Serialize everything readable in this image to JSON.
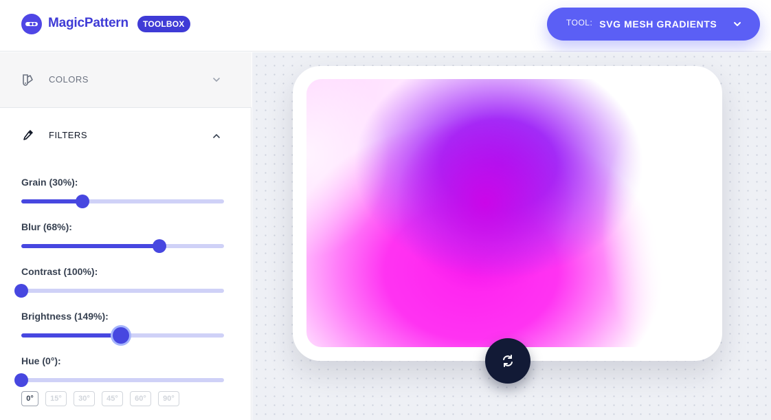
{
  "header": {
    "brand": "MagicPattern",
    "badge": "TOOLBOX",
    "tool_prefix": "TOOL:",
    "tool_name": "SVG MESH GRADIENTS"
  },
  "sidebar": {
    "colors_label": "COLORS",
    "filters_label": "FILTERS",
    "sliders": [
      {
        "label": "Grain (30%):",
        "percent": 30
      },
      {
        "label": "Blur (68%):",
        "percent": 68
      },
      {
        "label": "Contrast (100%):",
        "percent": 0
      },
      {
        "label": "Brightness (149%):",
        "percent": 49
      },
      {
        "label": "Hue (0°):",
        "percent": 0
      }
    ],
    "hue_presets": [
      "0°",
      "15°",
      "30°",
      "45°",
      "60°",
      "90°"
    ]
  },
  "colors": {
    "accent": "#4747e0",
    "tool_button": "#5b5ff5",
    "refresh_button": "#121a36",
    "gradient_magenta": "#ff22f0",
    "gradient_purple": "#9d1df5"
  },
  "icons": {
    "colors_section": "palette-icon",
    "filters_section": "eyedropper-icon",
    "refresh": "refresh-icon"
  }
}
